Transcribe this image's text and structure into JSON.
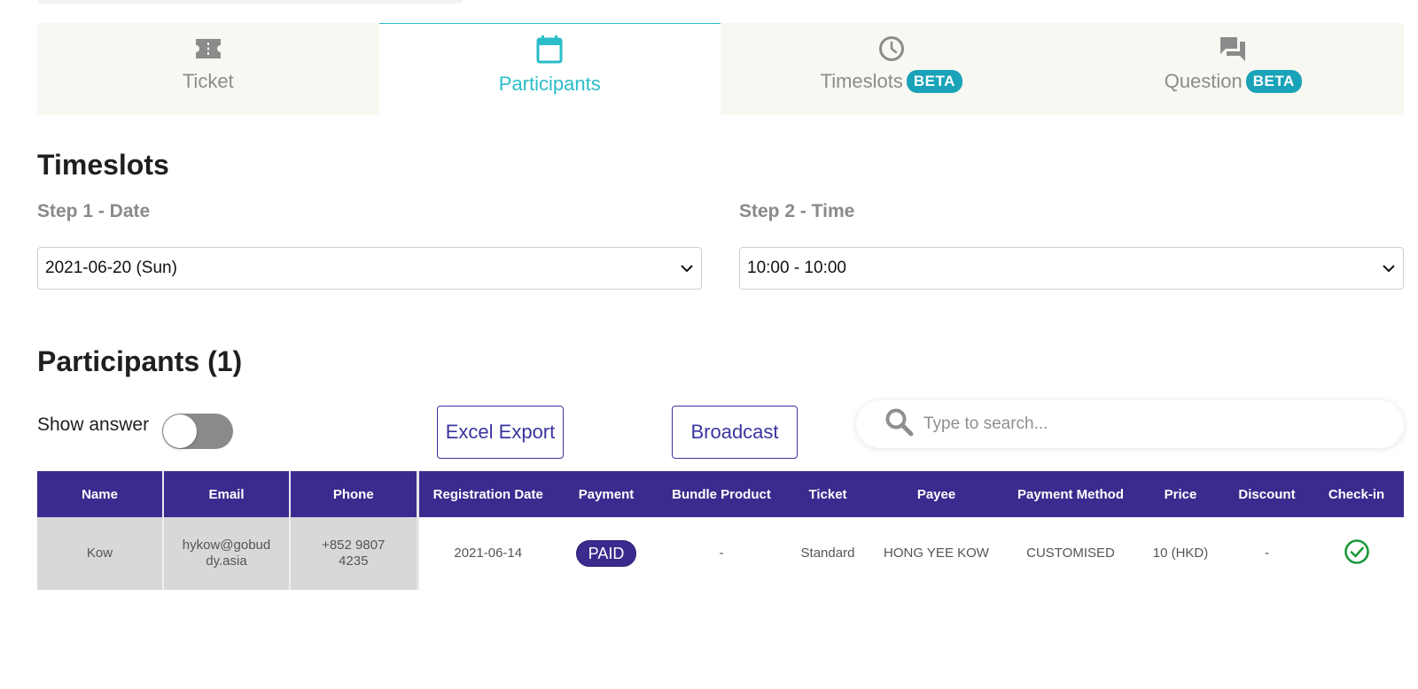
{
  "tabs": [
    {
      "label": "Ticket",
      "icon": "ticket-icon",
      "beta": ""
    },
    {
      "label": "Participants",
      "icon": "calendar-icon",
      "beta": ""
    },
    {
      "label": "Timeslots",
      "icon": "clock-icon",
      "beta": "BETA"
    },
    {
      "label": "Question",
      "icon": "chat-icon",
      "beta": "BETA"
    }
  ],
  "active_tab": "Participants",
  "timeslots": {
    "title": "Timeslots",
    "step1_label": "Step 1 - Date",
    "step1_value": "2021-06-20 (Sun)",
    "step2_label": "Step 2 - Time",
    "step2_value": "10:00 - 10:00"
  },
  "participants": {
    "title": "Participants (1)",
    "show_answer_label": "Show answer",
    "show_answer_on": false,
    "excel_export_label": "Excel Export",
    "broadcast_label": "Broadcast",
    "search_placeholder": "Type to search..."
  },
  "table": {
    "columns": [
      "Name",
      "Email",
      "Phone",
      "Registration Date",
      "Payment",
      "Bundle Product",
      "Ticket",
      "Payee",
      "Payment Method",
      "Price",
      "Discount",
      "Check-in"
    ],
    "rows": [
      {
        "name": "Kow",
        "email": "hykow@gobuddy.asia",
        "phone": "+852 9807 4235",
        "registration_date": "2021-06-14",
        "payment": "PAID",
        "bundle_product": "-",
        "ticket": "Standard",
        "payee": "HONG YEE KOW",
        "payment_method": "CUSTOMISED",
        "price": "10 (HKD)",
        "discount": "-",
        "checked_in": true
      }
    ]
  },
  "colors": {
    "accent": "#2bbdc8",
    "primary": "#3c2b8e",
    "beta_badge": "#1aa3b8",
    "check": "#1a9a3a"
  }
}
